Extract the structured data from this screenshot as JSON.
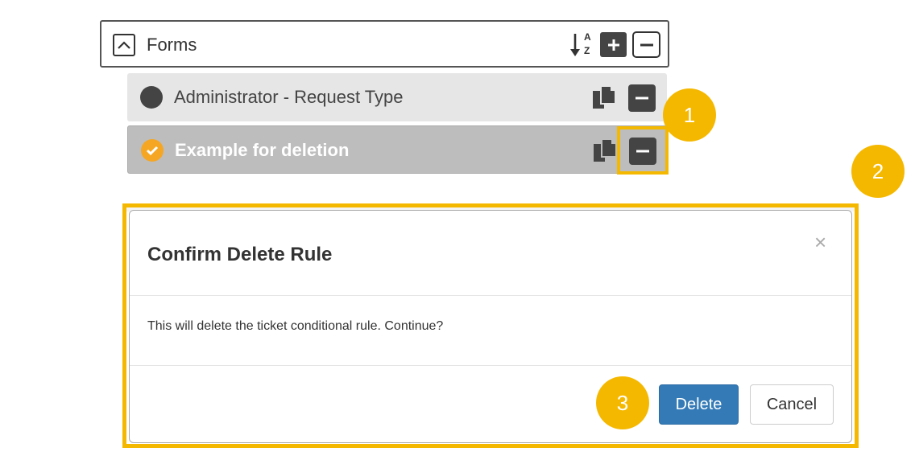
{
  "forms": {
    "title": "Forms",
    "sort_label_top": "A",
    "sort_label_bottom": "Z",
    "add_label": "+",
    "collapse_label": "−"
  },
  "rows": [
    {
      "label": "Administrator - Request Type",
      "status_icon": "circle-icon"
    },
    {
      "label": "Example for deletion",
      "status_icon": "check-circle-icon"
    }
  ],
  "callouts": {
    "one": "1",
    "two": "2",
    "three": "3"
  },
  "modal": {
    "title": "Confirm Delete Rule",
    "close": "×",
    "body": "This will delete the ticket conditional rule. Continue?",
    "delete_label": "Delete",
    "cancel_label": "Cancel"
  },
  "colors": {
    "highlight": "#f5b800",
    "primary": "#337ab7",
    "check": "#f5a623",
    "dark_button": "#444444"
  }
}
